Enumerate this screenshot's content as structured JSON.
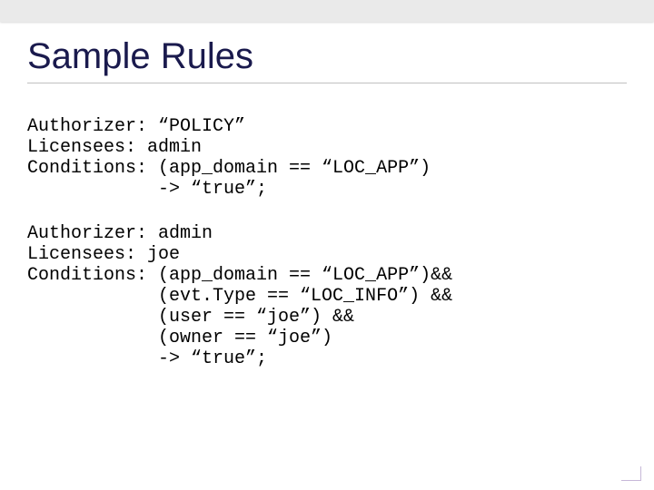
{
  "title": "Sample Rules",
  "rules": [
    {
      "text": "Authorizer: “POLICY”\nLicensees: admin\nConditions: (app_domain == “LOC_APP”)\n            -> “true”;"
    },
    {
      "text": "Authorizer: admin\nLicensees: joe\nConditions: (app_domain == “LOC_APP”)&&\n            (evt.Type == “LOC_INFO”) &&\n            (user == “joe”) &&\n            (owner == “joe”)\n            -> “true”;"
    }
  ]
}
